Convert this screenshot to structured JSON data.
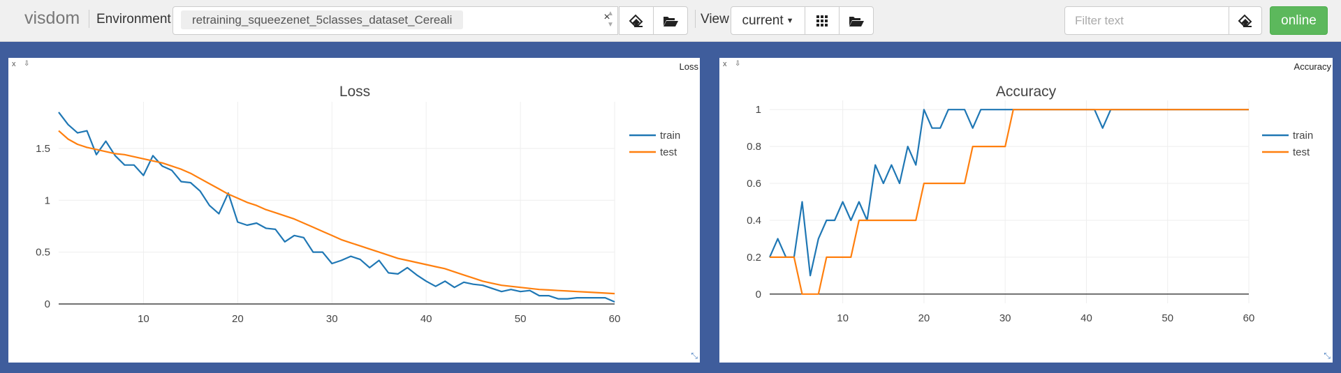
{
  "navbar": {
    "brand": "visdom",
    "environment_label": "Environment",
    "environment_chip": "retraining_squeezenet_5classes_dataset_Cereali",
    "clear_symbol": "×",
    "view_label": "View",
    "view_select": "current",
    "filter_placeholder": "Filter text",
    "online_label": "online",
    "icons": [
      "eraser-icon",
      "folder-open-icon",
      "grid-icon",
      "folder-open-icon",
      "eraser-icon",
      "caret-down-icon"
    ]
  },
  "panes": [
    {
      "header_title": "Loss",
      "close_symbol": "x",
      "download_symbol": "⇩",
      "resize_symbol": "⤡",
      "chart_data": {
        "type": "line",
        "title": "Loss",
        "xlabel": "",
        "ylabel": "",
        "xlim": [
          1,
          60
        ],
        "ylim": [
          0,
          1.95
        ],
        "x_ticks": [
          10,
          20,
          30,
          40,
          50,
          60
        ],
        "y_ticks": [
          0,
          0.5,
          1,
          1.5
        ],
        "y_tick_labels": [
          "0",
          "0.5",
          "1",
          "1.5"
        ],
        "grid": true,
        "legend_position": "top-right",
        "series": [
          {
            "name": "train",
            "color": "#1f77b4",
            "x": [
              1,
              2,
              3,
              4,
              5,
              6,
              7,
              8,
              9,
              10,
              11,
              12,
              13,
              14,
              15,
              16,
              17,
              18,
              19,
              20,
              21,
              22,
              23,
              24,
              25,
              26,
              27,
              28,
              29,
              30,
              31,
              32,
              33,
              34,
              35,
              36,
              37,
              38,
              39,
              40,
              41,
              42,
              43,
              44,
              45,
              46,
              47,
              48,
              49,
              50,
              51,
              52,
              53,
              54,
              55,
              56,
              57,
              58,
              59,
              60
            ],
            "values": [
              1.85,
              1.73,
              1.65,
              1.67,
              1.44,
              1.57,
              1.43,
              1.34,
              1.34,
              1.24,
              1.43,
              1.33,
              1.29,
              1.18,
              1.17,
              1.09,
              0.95,
              0.87,
              1.07,
              0.79,
              0.76,
              0.78,
              0.73,
              0.72,
              0.6,
              0.66,
              0.64,
              0.5,
              0.5,
              0.39,
              0.42,
              0.46,
              0.43,
              0.35,
              0.42,
              0.3,
              0.29,
              0.35,
              0.28,
              0.22,
              0.17,
              0.22,
              0.16,
              0.21,
              0.19,
              0.18,
              0.15,
              0.12,
              0.14,
              0.12,
              0.13,
              0.08,
              0.08,
              0.05,
              0.05,
              0.06,
              0.06,
              0.06,
              0.06,
              0.02
            ]
          },
          {
            "name": "test",
            "color": "#ff7f0e",
            "x": [
              1,
              2,
              3,
              4,
              5,
              6,
              7,
              8,
              9,
              10,
              11,
              12,
              13,
              14,
              15,
              16,
              17,
              18,
              19,
              20,
              21,
              22,
              23,
              24,
              25,
              26,
              27,
              28,
              29,
              30,
              31,
              32,
              33,
              34,
              35,
              36,
              37,
              38,
              39,
              40,
              41,
              42,
              43,
              44,
              45,
              46,
              47,
              48,
              49,
              50,
              51,
              52,
              53,
              54,
              55,
              56,
              57,
              58,
              59,
              60
            ],
            "values": [
              1.67,
              1.59,
              1.54,
              1.51,
              1.49,
              1.47,
              1.45,
              1.44,
              1.42,
              1.4,
              1.38,
              1.36,
              1.33,
              1.3,
              1.26,
              1.21,
              1.16,
              1.11,
              1.06,
              1.02,
              0.98,
              0.95,
              0.91,
              0.88,
              0.85,
              0.82,
              0.78,
              0.74,
              0.7,
              0.66,
              0.62,
              0.59,
              0.56,
              0.53,
              0.5,
              0.47,
              0.44,
              0.42,
              0.4,
              0.38,
              0.36,
              0.34,
              0.31,
              0.28,
              0.25,
              0.22,
              0.2,
              0.18,
              0.17,
              0.16,
              0.15,
              0.14,
              0.135,
              0.13,
              0.125,
              0.12,
              0.115,
              0.11,
              0.105,
              0.1
            ]
          }
        ]
      }
    },
    {
      "header_title": "Accuracy",
      "close_symbol": "x",
      "download_symbol": "⇩",
      "resize_symbol": "⤡",
      "chart_data": {
        "type": "line",
        "title": "Accuracy",
        "xlabel": "",
        "ylabel": "",
        "xlim": [
          1,
          60
        ],
        "ylim": [
          -0.05,
          1.05
        ],
        "x_ticks": [
          10,
          20,
          30,
          40,
          50,
          60
        ],
        "y_ticks": [
          0,
          0.2,
          0.4,
          0.6,
          0.8,
          1
        ],
        "y_tick_labels": [
          "0",
          "0.2",
          "0.4",
          "0.6",
          "0.8",
          "1"
        ],
        "grid": true,
        "legend_position": "top-right",
        "series": [
          {
            "name": "train",
            "color": "#1f77b4",
            "x": [
              1,
              2,
              3,
              4,
              5,
              6,
              7,
              8,
              9,
              10,
              11,
              12,
              13,
              14,
              15,
              16,
              17,
              18,
              19,
              20,
              21,
              22,
              23,
              24,
              25,
              26,
              27,
              28,
              29,
              30,
              31,
              32,
              33,
              34,
              35,
              36,
              37,
              38,
              39,
              40,
              41,
              42,
              43,
              44,
              45,
              46,
              47,
              48,
              49,
              50,
              51,
              52,
              53,
              54,
              55,
              56,
              57,
              58,
              59,
              60
            ],
            "values": [
              0.2,
              0.3,
              0.2,
              0.2,
              0.5,
              0.1,
              0.3,
              0.4,
              0.4,
              0.5,
              0.4,
              0.5,
              0.4,
              0.7,
              0.6,
              0.7,
              0.6,
              0.8,
              0.7,
              1,
              0.9,
              0.9,
              1,
              1,
              1,
              0.9,
              1,
              1,
              1,
              1,
              1,
              1,
              1,
              1,
              1,
              1,
              1,
              1,
              1,
              1,
              1,
              0.9,
              1,
              1,
              1,
              1,
              1,
              1,
              1,
              1,
              1,
              1,
              1,
              1,
              1,
              1,
              1,
              1,
              1,
              1
            ]
          },
          {
            "name": "test",
            "color": "#ff7f0e",
            "x": [
              1,
              2,
              3,
              4,
              5,
              6,
              7,
              8,
              9,
              10,
              11,
              12,
              13,
              14,
              15,
              16,
              17,
              18,
              19,
              20,
              21,
              22,
              23,
              24,
              25,
              26,
              27,
              28,
              29,
              30,
              31,
              32,
              33,
              34,
              35,
              36,
              37,
              38,
              39,
              40,
              41,
              42,
              43,
              44,
              45,
              46,
              47,
              48,
              49,
              50,
              51,
              52,
              53,
              54,
              55,
              56,
              57,
              58,
              59,
              60
            ],
            "values": [
              0.2,
              0.2,
              0.2,
              0.2,
              0,
              0,
              0,
              0.2,
              0.2,
              0.2,
              0.2,
              0.4,
              0.4,
              0.4,
              0.4,
              0.4,
              0.4,
              0.4,
              0.4,
              0.6,
              0.6,
              0.6,
              0.6,
              0.6,
              0.6,
              0.8,
              0.8,
              0.8,
              0.8,
              0.8,
              1,
              1,
              1,
              1,
              1,
              1,
              1,
              1,
              1,
              1,
              1,
              1,
              1,
              1,
              1,
              1,
              1,
              1,
              1,
              1,
              1,
              1,
              1,
              1,
              1,
              1,
              1,
              1,
              1,
              1
            ]
          }
        ]
      }
    }
  ]
}
